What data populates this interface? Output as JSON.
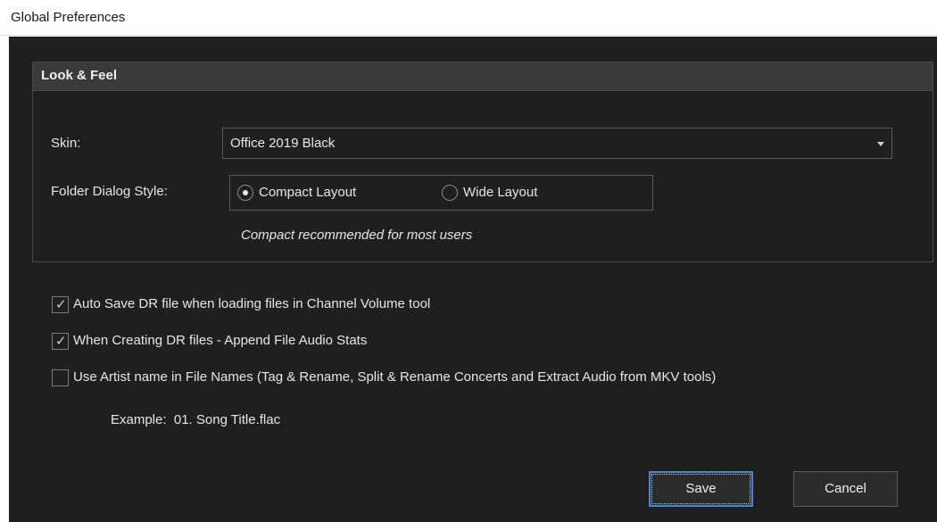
{
  "window": {
    "title": "Global Preferences"
  },
  "look_feel": {
    "header": "Look & Feel",
    "skin_label": "Skin:",
    "skin_value": "Office 2019 Black",
    "folder_style_label": "Folder Dialog Style:",
    "folder_style_options": [
      {
        "label": "Compact Layout",
        "checked": true
      },
      {
        "label": "Wide Layout",
        "checked": false
      }
    ],
    "hint": "Compact recommended for most users"
  },
  "options": [
    {
      "label": "Auto Save DR file when loading files in Channel Volume tool",
      "checked": true
    },
    {
      "label": "When Creating DR files - Append File Audio Stats",
      "checked": true
    },
    {
      "label": "Use Artist name in File Names (Tag & Rename, Split & Rename Concerts and Extract Audio from MKV tools)",
      "checked": false
    }
  ],
  "example_text": "Example:  01. Song Title.flac",
  "buttons": {
    "save": "Save",
    "cancel": "Cancel"
  },
  "colors": {
    "background": "#1f1f1f",
    "group_header": "#3a3a3a",
    "focus_border": "#3f8ad6"
  }
}
